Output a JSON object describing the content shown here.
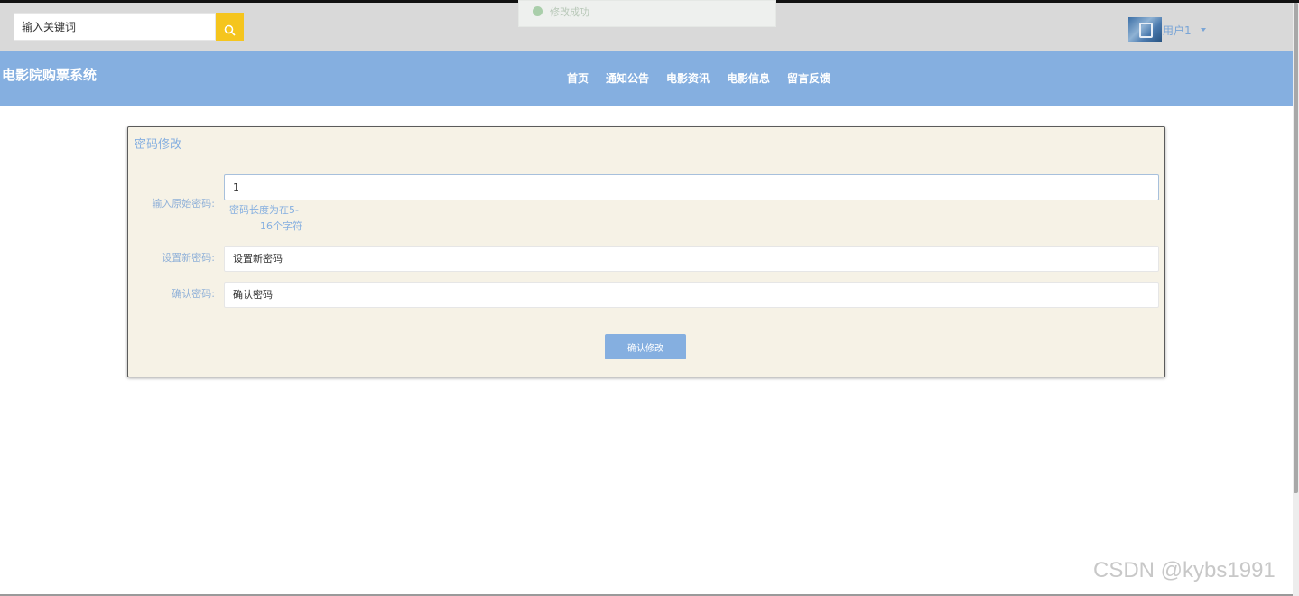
{
  "search": {
    "placeholder": "输入关键词",
    "icon": "search-icon"
  },
  "toast": {
    "text": "修改成功",
    "icon": "check-circle-icon",
    "color": "#a9ceaa"
  },
  "user": {
    "name": "用户1",
    "icon": "caret-down-icon"
  },
  "brand": {
    "title": "电影院购票系统"
  },
  "nav": {
    "items": [
      "首页",
      "通知公告",
      "电影资讯",
      "电影信息",
      "留言反馈"
    ]
  },
  "form": {
    "title": "密码修改",
    "old_password": {
      "label": "输入原始密码:",
      "value": "1"
    },
    "hint": [
      "密码长度为在5-",
      "16个字符"
    ],
    "new_password": {
      "label": "设置新密码:",
      "placeholder": "设置新密码"
    },
    "confirm_password": {
      "label": "确认密码:",
      "placeholder": "确认密码"
    },
    "submit_label": "确认修改"
  },
  "watermark": "CSDN @kybs1991",
  "colors": {
    "nav": "#85afe0",
    "topbar": "#d9d9d9",
    "panel": "#f6f2e6",
    "search_button": "#f5c51e"
  }
}
